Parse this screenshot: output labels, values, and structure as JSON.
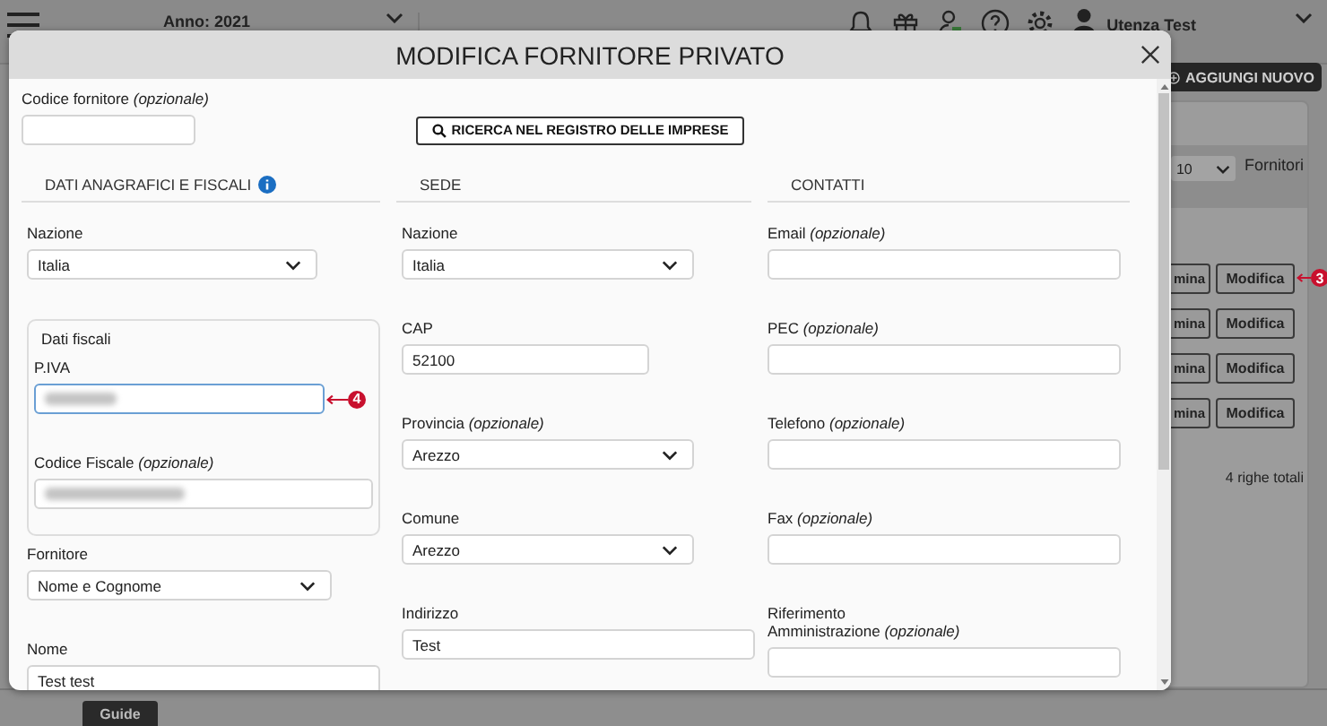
{
  "top_bar": {
    "year": "Anno: 2021",
    "user": "Utenza Test"
  },
  "background": {
    "add_button": "AGGIUNGI NUOVO",
    "page_size": "10",
    "page_size_label": "Fornitori",
    "rows": [
      {
        "delete": "mina",
        "edit": "Modifica",
        "callout": "3"
      },
      {
        "delete": "mina",
        "edit": "Modifica"
      },
      {
        "delete": "mina",
        "edit": "Modifica"
      },
      {
        "delete": "mina",
        "edit": "Modifica"
      }
    ],
    "total": "4 righe totali",
    "guide_tab": "Guide"
  },
  "modal": {
    "title": "MODIFICA FORNITORE PRIVATO",
    "supplier_code": {
      "label": "Codice fornitore *(opzionale)*",
      "focused": false
    },
    "search_button": "RICERCA NEL REGISTRO DELLE IMPRESE",
    "columns": [
      {
        "heading": "DATI ANAGRAFICI E FISCALI",
        "info": true,
        "fields": [
          {
            "kind": "select",
            "label": "Nazione",
            "value": "Italia",
            "focused": false
          },
          {
            "kind": "group",
            "title": "Dati fiscali",
            "fields": [
              {
                "kind": "input",
                "label": "P.IVA",
                "redacted": true,
                "focused": true,
                "callout": "4"
              },
              {
                "kind": "input",
                "label": "Codice Fiscale *(opzionale)*",
                "redacted": true,
                "focused": false
              }
            ]
          },
          {
            "kind": "select",
            "label": "Fornitore",
            "value": "Nome e Cognome",
            "focused": false
          },
          {
            "kind": "input",
            "label": "Nome",
            "value": "Test test",
            "focused": false
          }
        ]
      },
      {
        "heading": "SEDE",
        "info": false,
        "fields": [
          {
            "kind": "select",
            "label": "Nazione",
            "value": "Italia",
            "focused": false
          },
          {
            "kind": "input",
            "label": "CAP",
            "value": "52100",
            "focused": false
          },
          {
            "kind": "select",
            "label": "Provincia *(opzionale)*",
            "value": "Arezzo",
            "focused": false
          },
          {
            "kind": "select",
            "label": "Comune",
            "value": "Arezzo",
            "focused": false
          },
          {
            "kind": "input",
            "label": "Indirizzo",
            "value": "Test",
            "focused": false
          }
        ]
      },
      {
        "heading": "CONTATTI",
        "info": false,
        "fields": [
          {
            "kind": "input",
            "label": "Email *(opzionale)*",
            "focused": false
          },
          {
            "kind": "input",
            "label": "PEC *(opzionale)*",
            "focused": false
          },
          {
            "kind": "input",
            "label": "Telefono *(opzionale)*",
            "focused": false
          },
          {
            "kind": "input",
            "label": "Fax *(opzionale)*",
            "focused": false
          },
          {
            "kind": "input",
            "label_lines": [
              "Riferimento",
              "Amministrazione *(opzionale)*"
            ],
            "focused": false
          }
        ]
      }
    ]
  }
}
